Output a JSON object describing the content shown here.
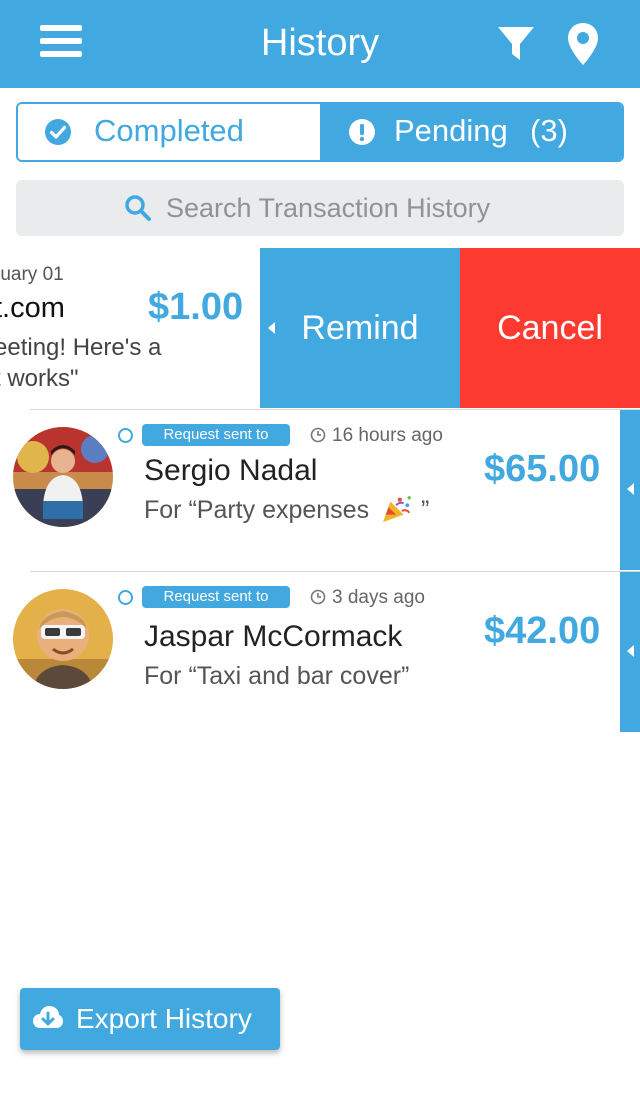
{
  "header": {
    "title": "History",
    "menu_icon": "hamburger-icon",
    "filter_icon": "filter-icon",
    "location_icon": "location-pin-icon",
    "background": "#41a8e0"
  },
  "tabs": {
    "completed_label": "Completed",
    "pending_label": "Pending",
    "pending_count": "(3)"
  },
  "search": {
    "placeholder": "Search Transaction History"
  },
  "swiped_item": {
    "date": "ruary 01",
    "name": "t.com",
    "amount": "$1.00",
    "note_line1": "eeting! Here's a",
    "note_line2": "t works\"",
    "remind_label": "Remind",
    "cancel_label": "Cancel"
  },
  "transactions": [
    {
      "status": "Request sent to",
      "time": "16 hours ago",
      "name": "Sergio Nadal",
      "note": "For “Party expenses",
      "note_end": "”",
      "emoji_icon": "party-popper-icon",
      "amount": "$65.00"
    },
    {
      "status": "Request sent to",
      "time": "3 days ago",
      "name": "Jaspar McCormack",
      "note": "For “Taxi and bar cover”",
      "amount": "$42.00"
    }
  ],
  "export": {
    "label": "Export History"
  },
  "colors": {
    "accent": "#41a8e0",
    "danger": "#fd3a30",
    "search_bg": "#e9ebed"
  }
}
